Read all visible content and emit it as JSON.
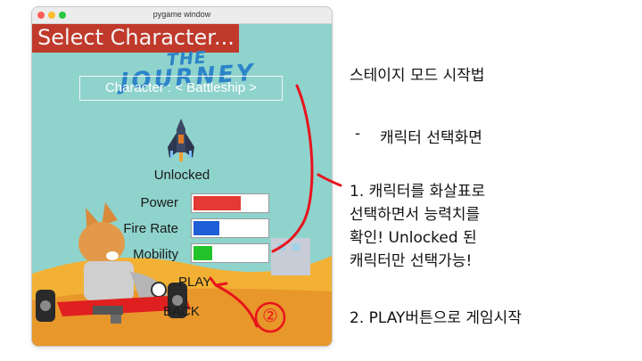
{
  "window": {
    "title": "pygame window"
  },
  "game": {
    "header": "Select Character...",
    "logo_top": "THE",
    "logo_bottom": "JOURNEY",
    "character_selector": "Character : < Battleship >",
    "status": "Unlocked",
    "stats": [
      {
        "label": "Power",
        "value": 0.65,
        "color": "#e53935"
      },
      {
        "label": "Fire Rate",
        "value": 0.35,
        "color": "#1e5fd8"
      },
      {
        "label": "Mobility",
        "value": 0.26,
        "color": "#22c32a"
      }
    ],
    "play_label": "PLAY",
    "back_label": "BACK"
  },
  "notes": {
    "title": "스테이지 모드 시작법",
    "bullet_dash": "-",
    "bullet": "캐릭터 선택화면",
    "step1_line1": "1. 캐릭터를 화살표로",
    "step1_line2": "선택하면서 능력치를",
    "step1_line3": "확인! Unlocked 된",
    "step1_line4": "캐릭터만 선택가능!",
    "step2": "2. PLAY버튼으로 게임시작"
  },
  "annotation": {
    "circled_number": "②",
    "color": "#e8141c"
  }
}
